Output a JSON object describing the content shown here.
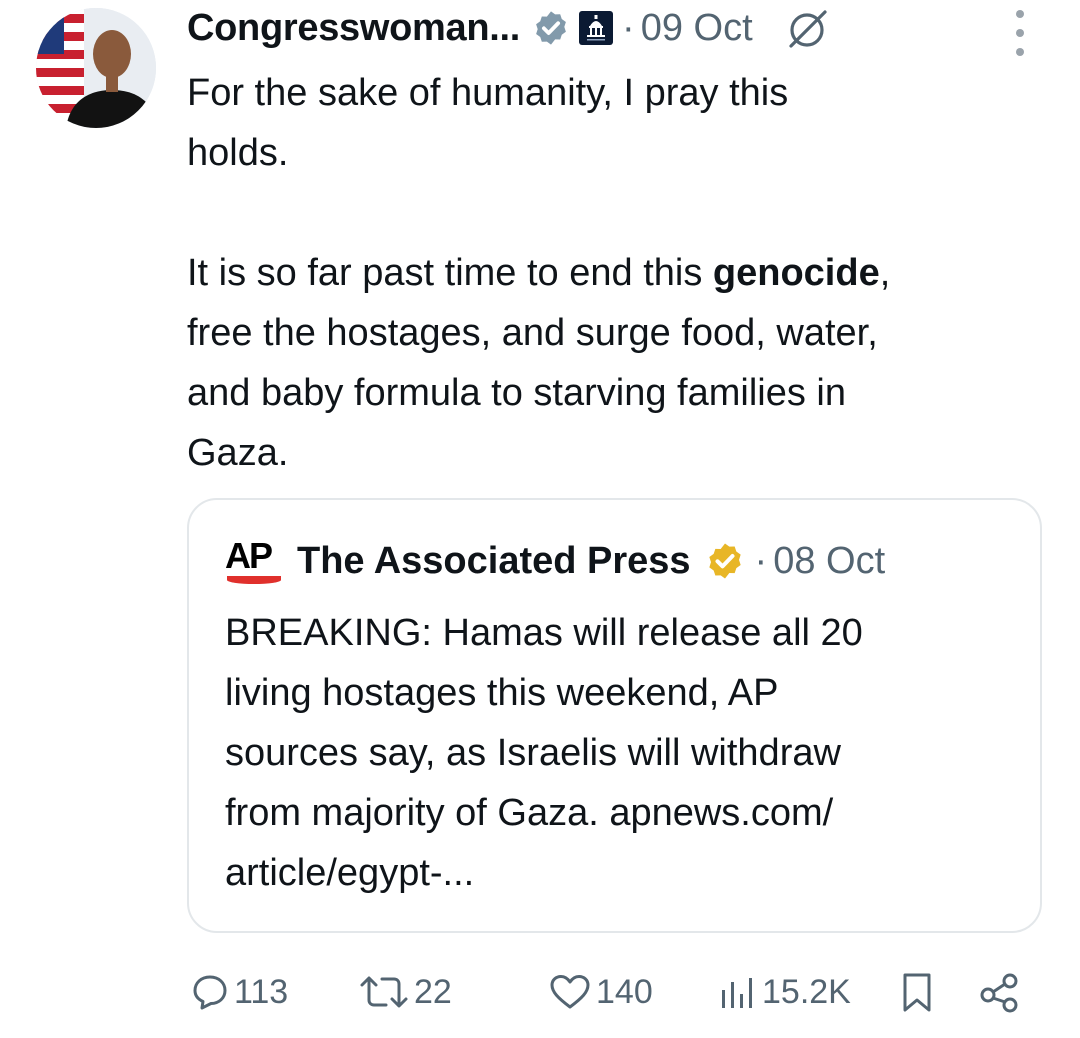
{
  "post": {
    "author_name": "Congresswoman...",
    "dot": "·",
    "timestamp": "09 Oct",
    "text_part1": "For the sake of humanity, I pray this\nholds.\n\nIt is so far past time to end this ",
    "text_bold": "genocide",
    "text_part2": ",\nfree the hostages, and surge food, water,\nand baby formula to starving families in\nGaza."
  },
  "quote": {
    "author_name": "The Associated Press",
    "logo_text": "AP",
    "dot": "·",
    "timestamp": "08 Oct",
    "text": "BREAKING: Hamas will release all 20\nliving hostages this weekend, AP\nsources say, as Israelis will withdraw\nfrom majority of Gaza. apnews.com/\narticle/egypt-..."
  },
  "actions": {
    "replies": "113",
    "reposts": "22",
    "likes": "140",
    "views": "15.2K"
  },
  "icons": {
    "verified_badge": "verified-grey-check",
    "government_badge": "capitol-building",
    "subscribe": "circle-slash-icon",
    "more": "vertical-ellipsis",
    "quote_badge": "verified-gold-check",
    "reply": "speech-bubble",
    "repost": "repost-arrows",
    "like": "heart",
    "views": "bar-chart",
    "bookmark": "bookmark",
    "share": "share-nodes"
  },
  "colors": {
    "text": "#0f1419",
    "secondary": "#536471",
    "gold_badge": "#e8b626",
    "grey_badge": "#829aab",
    "ap_red": "#e0302c",
    "card_border": "#e3e7ea"
  }
}
